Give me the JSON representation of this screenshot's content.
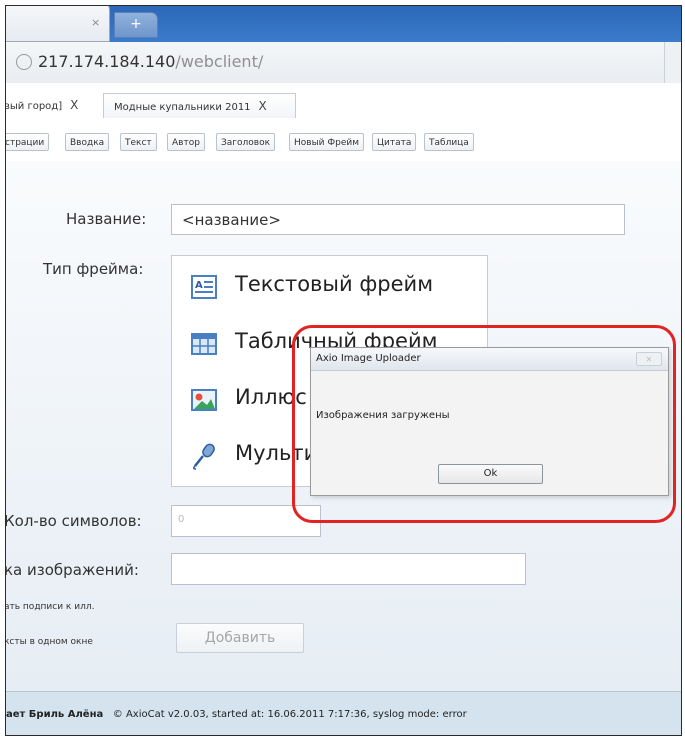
{
  "browser": {
    "tab_close": "×",
    "new_tab": "+",
    "url_host": "217.174.184.140",
    "url_path": "/webclient/"
  },
  "doc_tabs": [
    {
      "label": "вый город]",
      "close": "X"
    },
    {
      "label": "Модные купальники 2011",
      "close": "X"
    }
  ],
  "toolbar": {
    "buttons": [
      "страции",
      "Вводка",
      "Текст",
      "Автор",
      "Заголовок",
      "Новый Фрейм",
      "Цитата",
      "Таблица"
    ]
  },
  "form": {
    "name_label": "Название:",
    "name_value": "<название>",
    "frame_type_label": "Тип фрейма:",
    "frame_types": [
      "Текстовый фрейм",
      "Табличный фрейм",
      "Иллюс",
      "Мульти"
    ],
    "chars_label": "Кол-во символов:",
    "chars_value": "0",
    "images_label": "ка изображений:",
    "captions_label": "ать подписи к илл.",
    "onewindow_label": "ксты в одном окне",
    "add_button": "Добавить"
  },
  "dialog": {
    "title": "Axio Image Uploader",
    "close": "✕",
    "message": "Изображения загружены",
    "ok_button": "Ok"
  },
  "status": {
    "user": "ает Бриль Алёна",
    "info": "© AxioCat v2.0.03, started at: 16.06.2011 7:17:36, syslog mode: error"
  },
  "colors": {
    "tabstrip": "#3b7bcc",
    "status_bg": "#d4e3ee",
    "highlight": "#e32222"
  }
}
